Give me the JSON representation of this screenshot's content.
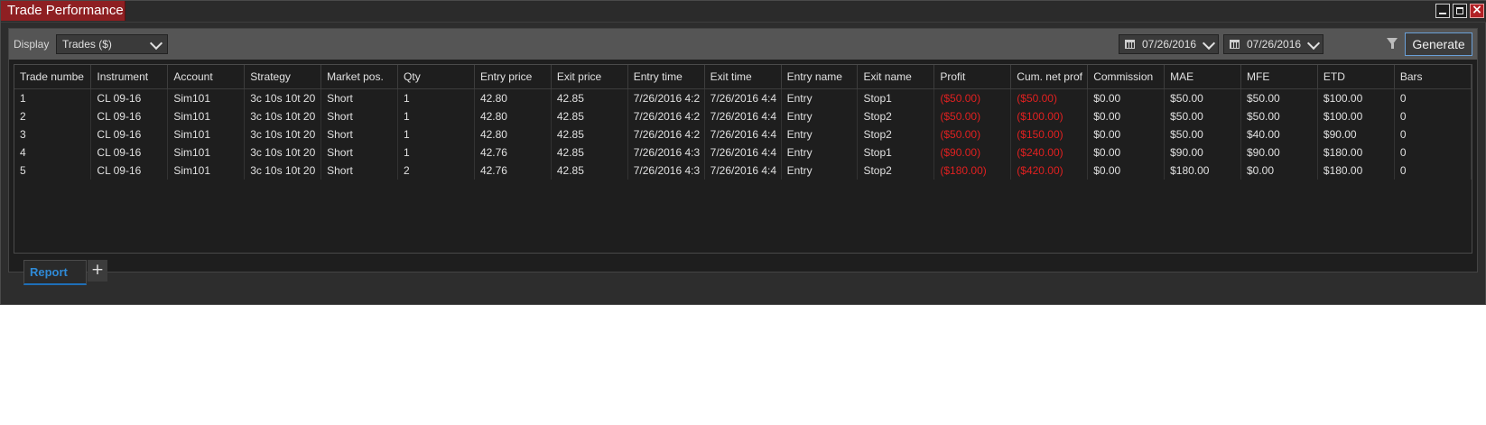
{
  "window": {
    "title": "Trade Performance"
  },
  "toolbar": {
    "display_label": "Display",
    "display_value": "Trades ($)",
    "from_date": "07/26/2016",
    "to_date": "07/26/2016",
    "generate_label": "Generate"
  },
  "table": {
    "headers": [
      "Trade numbe",
      "Instrument",
      "Account",
      "Strategy",
      "Market pos.",
      "Qty",
      "Entry price",
      "Exit price",
      "Entry time",
      "Exit time",
      "Entry name",
      "Exit name",
      "Profit",
      "Cum. net prof",
      "Commission",
      "MAE",
      "MFE",
      "ETD",
      "Bars"
    ],
    "rows": [
      [
        "1",
        "CL 09-16",
        "Sim101",
        "3c 10s 10t 20",
        "Short",
        "1",
        "42.80",
        "42.85",
        "7/26/2016 4:2",
        "7/26/2016 4:4",
        "Entry",
        "Stop1",
        "($50.00)",
        "($50.00)",
        "$0.00",
        "$50.00",
        "$50.00",
        "$100.00",
        "0"
      ],
      [
        "2",
        "CL 09-16",
        "Sim101",
        "3c 10s 10t 20",
        "Short",
        "1",
        "42.80",
        "42.85",
        "7/26/2016 4:2",
        "7/26/2016 4:4",
        "Entry",
        "Stop2",
        "($50.00)",
        "($100.00)",
        "$0.00",
        "$50.00",
        "$50.00",
        "$100.00",
        "0"
      ],
      [
        "3",
        "CL 09-16",
        "Sim101",
        "3c 10s 10t 20",
        "Short",
        "1",
        "42.80",
        "42.85",
        "7/26/2016 4:2",
        "7/26/2016 4:4",
        "Entry",
        "Stop2",
        "($50.00)",
        "($150.00)",
        "$0.00",
        "$50.00",
        "$40.00",
        "$90.00",
        "0"
      ],
      [
        "4",
        "CL 09-16",
        "Sim101",
        "3c 10s 10t 20",
        "Short",
        "1",
        "42.76",
        "42.85",
        "7/26/2016 4:3",
        "7/26/2016 4:4",
        "Entry",
        "Stop1",
        "($90.00)",
        "($240.00)",
        "$0.00",
        "$90.00",
        "$90.00",
        "$180.00",
        "0"
      ],
      [
        "5",
        "CL 09-16",
        "Sim101",
        "3c 10s 10t 20",
        "Short",
        "2",
        "42.76",
        "42.85",
        "7/26/2016 4:3",
        "7/26/2016 4:4",
        "Entry",
        "Stop2",
        "($180.00)",
        "($420.00)",
        "$0.00",
        "$180.00",
        "$0.00",
        "$180.00",
        "0"
      ]
    ]
  },
  "tabs": {
    "report_label": "Report",
    "add_label": "+"
  },
  "colors": {
    "accent": "#8e1f22",
    "negative": "#e02020",
    "tab_active": "#2f8ad6"
  }
}
